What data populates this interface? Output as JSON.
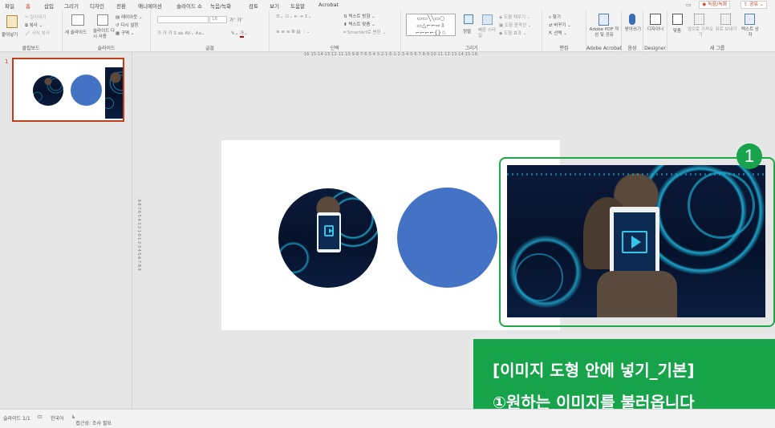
{
  "menu": {
    "tabs": [
      "파일",
      "홈",
      "삽입",
      "그리기",
      "디자인",
      "전환",
      "애니메이션",
      "슬라이드 쇼",
      "녹음/녹화",
      "검토",
      "보기",
      "도움말",
      "Acrobat"
    ],
    "active_tab": "홈",
    "record_button": "녹음/녹화",
    "share_button": "공유"
  },
  "ribbon": {
    "clipboard": {
      "label": "클립보드",
      "paste": "붙여넣기",
      "cut": "잘라내기",
      "copy": "복사",
      "format_painter": "서식 복사"
    },
    "slides": {
      "label": "슬라이드",
      "new_slide": "새 슬라이드",
      "reuse": "슬라이드 다시 사용",
      "layout": "레이아웃",
      "reset": "다시 설정",
      "section": "구역"
    },
    "font": {
      "label": "글꼴",
      "size": "18"
    },
    "paragraph": {
      "label": "단락",
      "text_direction": "텍스트 방향",
      "align_text": "텍스트 맞춤",
      "smartart": "SmartArt로 변환"
    },
    "drawing": {
      "label": "그리기",
      "arrange": "정렬",
      "quick_styles": "빠른 스타일",
      "fill": "도형 채우기",
      "outline": "도형 윤곽선",
      "effects": "도형 효과"
    },
    "editing": {
      "label": "편집",
      "find": "찾기",
      "replace": "바꾸기",
      "select": "선택"
    },
    "acrobat": {
      "label": "Adobe Acrobat",
      "create": "Adobe PDF 작성 및 공유"
    },
    "voice": {
      "label": "음성",
      "dictate": "받아쓰기"
    },
    "designer": {
      "label": "Designer",
      "designer": "디자이너"
    },
    "new_group": {
      "label": "새 그룹",
      "align": "맞춤",
      "bring_forward": "앞으로 가져오기",
      "send_backward": "뒤로 보내기",
      "text_fit": "텍스트 상자"
    }
  },
  "ruler": {
    "horizontal": "·16·15·14·13·12·11·10·9·8·7·6·5·4·3·2·1·0·1·2·3·4·5·6·7·8·9·10·11·12·13·14·15·16·",
    "vertical": "·9·8·7·6·5·4·3·2·1·0·1·2·3·4·5·6·7·8·9·"
  },
  "thumbnail": {
    "slide_number": "1"
  },
  "callout": {
    "badge": "1",
    "line1": "[이미지 도형 안에 넣기_기본]",
    "line2": "①원하는 이미지를 불러옵니다"
  },
  "status": {
    "slide": "슬라이드 1/1",
    "language": "한국어",
    "accessibility": "접근성: 조사 필요"
  },
  "colors": {
    "accent": "#c43e1c",
    "circle_fill": "#4472c4",
    "callout": "#16a34a"
  }
}
